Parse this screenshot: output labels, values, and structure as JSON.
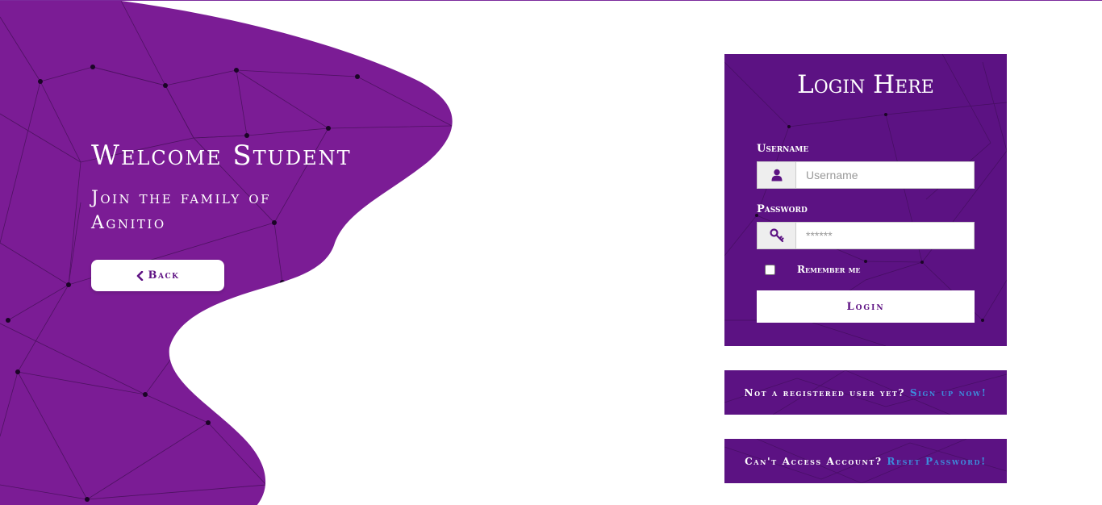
{
  "colors": {
    "brand_purple": "#7b1c95",
    "panel_purple": "#5c1283",
    "link_blue": "#3c8ddc",
    "white": "#ffffff"
  },
  "hero": {
    "title": "Welcome Student",
    "subtitle": "Join the family of Agnitio",
    "back_icon": "chevron-left-icon",
    "back_label": "Back"
  },
  "login": {
    "title": "Login Here",
    "username_label": "Username",
    "username_icon": "user-icon",
    "username_placeholder": "Username",
    "username_value": "",
    "password_label": "Password",
    "password_icon": "key-icon",
    "password_placeholder": "******",
    "password_value": "",
    "remember_label": "Remember me",
    "remember_checked": false,
    "submit_label": "Login"
  },
  "signup": {
    "text": "Not a registered user yet?",
    "link": "Sign up now!"
  },
  "reset": {
    "text": "Can't Access Account?",
    "link": "Reset Password!"
  }
}
